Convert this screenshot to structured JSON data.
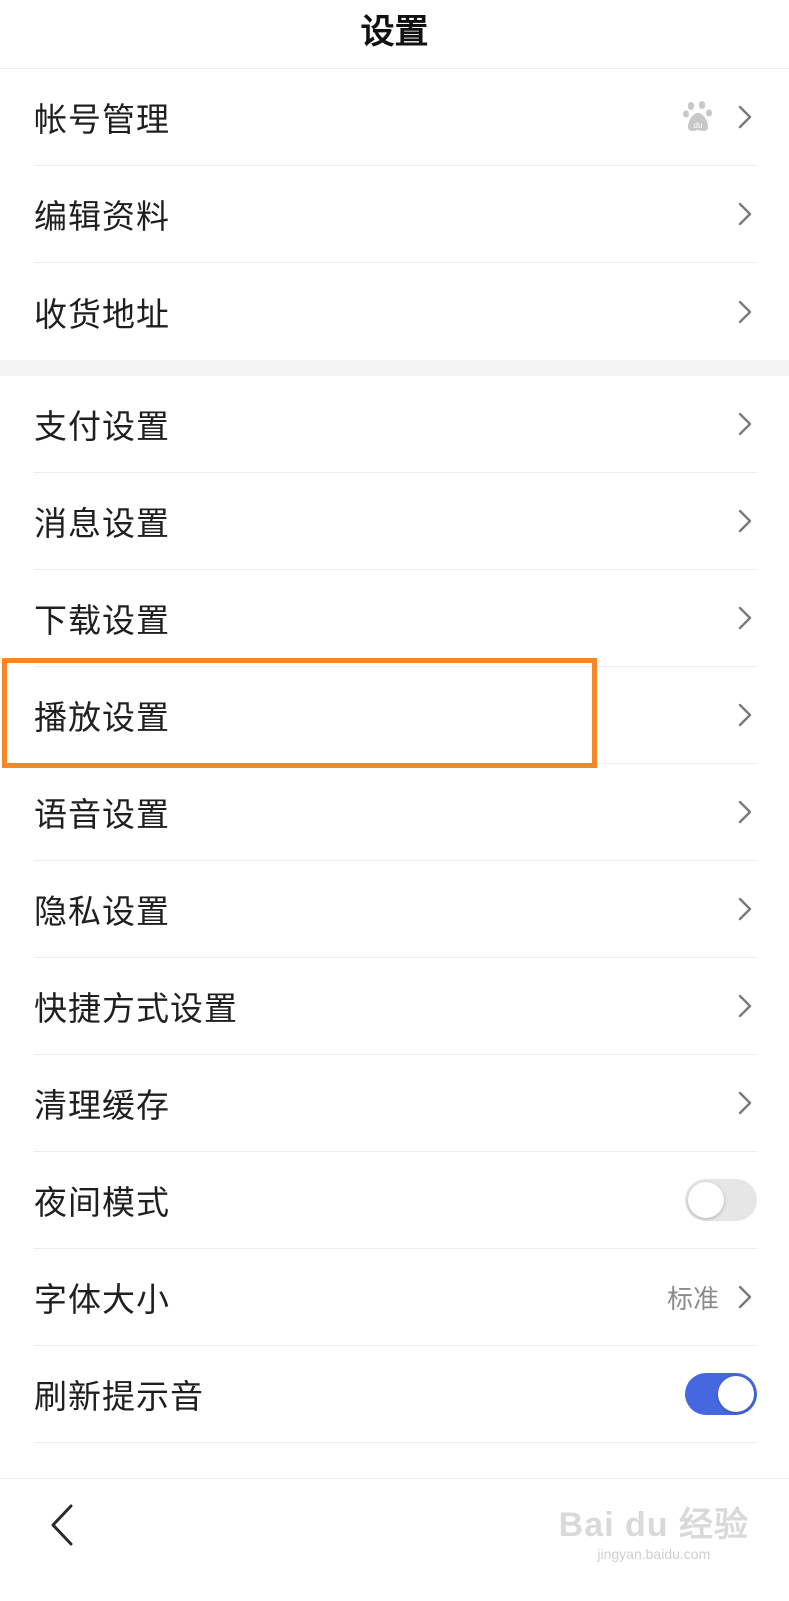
{
  "header": {
    "title": "设置"
  },
  "group1": {
    "items": [
      {
        "label": "帐号管理",
        "icon": "baidu-paw-icon"
      },
      {
        "label": "编辑资料"
      },
      {
        "label": "收货地址"
      }
    ]
  },
  "group2": {
    "items": [
      {
        "label": "支付设置"
      },
      {
        "label": "消息设置"
      },
      {
        "label": "下载设置"
      },
      {
        "label": "播放设置",
        "highlighted": true
      },
      {
        "label": "语音设置"
      },
      {
        "label": "隐私设置"
      },
      {
        "label": "快捷方式设置"
      },
      {
        "label": "清理缓存"
      },
      {
        "label": "夜间模式",
        "toggle": false
      },
      {
        "label": "字体大小",
        "value": "标准"
      },
      {
        "label": "刷新提示音",
        "toggle": true
      }
    ]
  },
  "colors": {
    "highlight": "#f5862a",
    "toggle_on": "#4568e0",
    "toggle_off": "#e6e6e6"
  },
  "footer": {
    "watermark_main": "Bai du 经验",
    "watermark_sub": "jingyan.baidu.com"
  }
}
